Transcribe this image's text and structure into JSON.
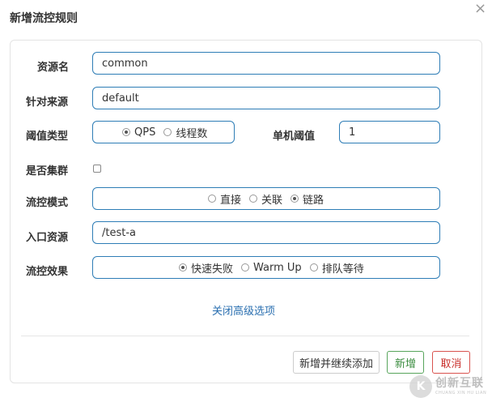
{
  "dialog": {
    "title": "新增流控规则",
    "close": "×"
  },
  "form": {
    "resource": {
      "label": "资源名",
      "value": "common"
    },
    "limit_app": {
      "label": "针对来源",
      "value": "default"
    },
    "grade": {
      "label": "阈值类型",
      "options": [
        "QPS",
        "线程数"
      ],
      "selected": "QPS"
    },
    "threshold": {
      "label": "单机阈值",
      "value": "1"
    },
    "cluster": {
      "label": "是否集群",
      "checked": false
    },
    "strategy": {
      "label": "流控模式",
      "options": [
        "直接",
        "关联",
        "链路"
      ],
      "selected": "链路"
    },
    "ref_resource": {
      "label": "入口资源",
      "value": "/test-a"
    },
    "control_behavior": {
      "label": "流控效果",
      "options": [
        "快速失败",
        "Warm Up",
        "排队等待"
      ],
      "selected": "快速失败"
    },
    "advanced_link": "关闭高级选项"
  },
  "buttons": {
    "add_continue": "新增并继续添加",
    "add": "新增",
    "cancel": "取消"
  },
  "watermark": {
    "logo": "K",
    "text": "创新互联",
    "sub": "CHUANG XIN HU LIAN"
  },
  "colors": {
    "input_border": "#2e7db6",
    "link": "#2a6fb0",
    "add_button": "#58a55c",
    "cancel_button": "#d9534f"
  }
}
